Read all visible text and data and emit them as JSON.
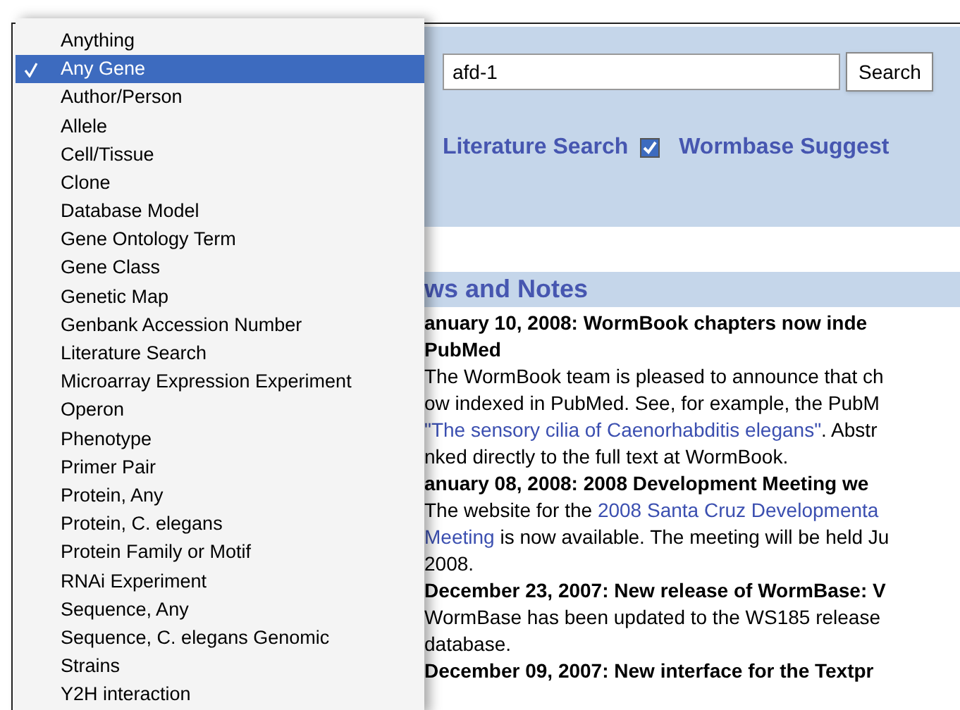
{
  "menu": {
    "items": [
      {
        "label": "Anything",
        "selected": false
      },
      {
        "label": "Any Gene",
        "selected": true
      },
      {
        "label": "Author/Person",
        "selected": false
      },
      {
        "label": "Allele",
        "selected": false
      },
      {
        "label": "Cell/Tissue",
        "selected": false
      },
      {
        "label": "Clone",
        "selected": false
      },
      {
        "label": "Database Model",
        "selected": false
      },
      {
        "label": "Gene Ontology Term",
        "selected": false
      },
      {
        "label": "Gene Class",
        "selected": false
      },
      {
        "label": "Genetic Map",
        "selected": false
      },
      {
        "label": "Genbank Accession Number",
        "selected": false
      },
      {
        "label": "Literature Search",
        "selected": false
      },
      {
        "label": "Microarray Expression Experiment",
        "selected": false
      },
      {
        "label": "Operon",
        "selected": false
      },
      {
        "label": "Phenotype",
        "selected": false
      },
      {
        "label": "Primer Pair",
        "selected": false
      },
      {
        "label": "Protein, Any",
        "selected": false
      },
      {
        "label": "Protein, C. elegans",
        "selected": false
      },
      {
        "label": "Protein Family or Motif",
        "selected": false
      },
      {
        "label": "RNAi Experiment",
        "selected": false
      },
      {
        "label": "Sequence, Any",
        "selected": false
      },
      {
        "label": "Sequence, C. elegans Genomic",
        "selected": false
      },
      {
        "label": "Strains",
        "selected": false
      },
      {
        "label": "Y2H interaction",
        "selected": false
      }
    ]
  },
  "search": {
    "value": "afd-1",
    "button": "Search"
  },
  "options": [
    {
      "kind": "link",
      "label": "Literature Search"
    },
    {
      "kind": "checkbox",
      "label": "Wormbase Suggest",
      "checked": true
    }
  ],
  "news": {
    "title": "ws and Notes",
    "lines": [
      {
        "kind": "heading",
        "segments": [
          {
            "kind": "text",
            "text": "anuary 10, 2008: WormBook chapters now inde"
          }
        ]
      },
      {
        "kind": "heading",
        "segments": [
          {
            "kind": "text",
            "text": "PubMed"
          }
        ]
      },
      {
        "kind": "text",
        "segments": [
          {
            "kind": "text",
            "text": "The WormBook team is pleased to announce that ch"
          }
        ]
      },
      {
        "kind": "text",
        "segments": [
          {
            "kind": "text",
            "text": "ow indexed in PubMed. See, for example, the PubM"
          }
        ]
      },
      {
        "kind": "text",
        "segments": [
          {
            "kind": "link",
            "text": "\"The sensory cilia of Caenorhabditis elegans\""
          },
          {
            "kind": "text",
            "text": ". Abstr"
          }
        ]
      },
      {
        "kind": "text",
        "segments": [
          {
            "kind": "text",
            "text": "nked directly to the full text at WormBook."
          }
        ]
      },
      {
        "kind": "heading",
        "segments": [
          {
            "kind": "text",
            "text": "anuary 08, 2008: 2008 Development Meeting we"
          }
        ]
      },
      {
        "kind": "text",
        "segments": [
          {
            "kind": "text",
            "text": "The website for the "
          },
          {
            "kind": "link",
            "text": "2008 Santa Cruz Developmenta"
          }
        ]
      },
      {
        "kind": "text",
        "segments": [
          {
            "kind": "link",
            "text": "Meeting"
          },
          {
            "kind": "text",
            "text": " is now available. The meeting will be held Ju"
          }
        ]
      },
      {
        "kind": "text",
        "segments": [
          {
            "kind": "text",
            "text": "2008."
          }
        ]
      },
      {
        "kind": "heading",
        "segments": [
          {
            "kind": "text",
            "text": "December 23, 2007: New release of WormBase: V"
          }
        ]
      },
      {
        "kind": "text",
        "segments": [
          {
            "kind": "text",
            "text": "WormBase has been updated to the WS185 release"
          }
        ]
      },
      {
        "kind": "text",
        "segments": [
          {
            "kind": "text",
            "text": "database."
          }
        ]
      },
      {
        "kind": "heading",
        "segments": [
          {
            "kind": "text",
            "text": "December 09, 2007: New interface for the Textpr"
          }
        ]
      }
    ]
  }
}
